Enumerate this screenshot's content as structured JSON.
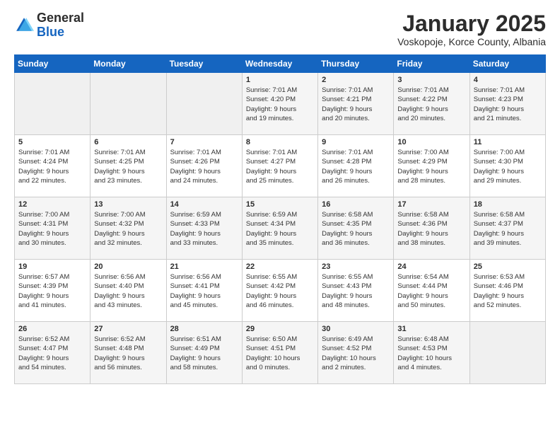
{
  "logo": {
    "general": "General",
    "blue": "Blue"
  },
  "header": {
    "title": "January 2025",
    "subtitle": "Voskopoje, Korce County, Albania"
  },
  "days_of_week": [
    "Sunday",
    "Monday",
    "Tuesday",
    "Wednesday",
    "Thursday",
    "Friday",
    "Saturday"
  ],
  "weeks": [
    [
      {
        "day": "",
        "info": ""
      },
      {
        "day": "",
        "info": ""
      },
      {
        "day": "",
        "info": ""
      },
      {
        "day": "1",
        "info": "Sunrise: 7:01 AM\nSunset: 4:20 PM\nDaylight: 9 hours\nand 19 minutes."
      },
      {
        "day": "2",
        "info": "Sunrise: 7:01 AM\nSunset: 4:21 PM\nDaylight: 9 hours\nand 20 minutes."
      },
      {
        "day": "3",
        "info": "Sunrise: 7:01 AM\nSunset: 4:22 PM\nDaylight: 9 hours\nand 20 minutes."
      },
      {
        "day": "4",
        "info": "Sunrise: 7:01 AM\nSunset: 4:23 PM\nDaylight: 9 hours\nand 21 minutes."
      }
    ],
    [
      {
        "day": "5",
        "info": "Sunrise: 7:01 AM\nSunset: 4:24 PM\nDaylight: 9 hours\nand 22 minutes."
      },
      {
        "day": "6",
        "info": "Sunrise: 7:01 AM\nSunset: 4:25 PM\nDaylight: 9 hours\nand 23 minutes."
      },
      {
        "day": "7",
        "info": "Sunrise: 7:01 AM\nSunset: 4:26 PM\nDaylight: 9 hours\nand 24 minutes."
      },
      {
        "day": "8",
        "info": "Sunrise: 7:01 AM\nSunset: 4:27 PM\nDaylight: 9 hours\nand 25 minutes."
      },
      {
        "day": "9",
        "info": "Sunrise: 7:01 AM\nSunset: 4:28 PM\nDaylight: 9 hours\nand 26 minutes."
      },
      {
        "day": "10",
        "info": "Sunrise: 7:00 AM\nSunset: 4:29 PM\nDaylight: 9 hours\nand 28 minutes."
      },
      {
        "day": "11",
        "info": "Sunrise: 7:00 AM\nSunset: 4:30 PM\nDaylight: 9 hours\nand 29 minutes."
      }
    ],
    [
      {
        "day": "12",
        "info": "Sunrise: 7:00 AM\nSunset: 4:31 PM\nDaylight: 9 hours\nand 30 minutes."
      },
      {
        "day": "13",
        "info": "Sunrise: 7:00 AM\nSunset: 4:32 PM\nDaylight: 9 hours\nand 32 minutes."
      },
      {
        "day": "14",
        "info": "Sunrise: 6:59 AM\nSunset: 4:33 PM\nDaylight: 9 hours\nand 33 minutes."
      },
      {
        "day": "15",
        "info": "Sunrise: 6:59 AM\nSunset: 4:34 PM\nDaylight: 9 hours\nand 35 minutes."
      },
      {
        "day": "16",
        "info": "Sunrise: 6:58 AM\nSunset: 4:35 PM\nDaylight: 9 hours\nand 36 minutes."
      },
      {
        "day": "17",
        "info": "Sunrise: 6:58 AM\nSunset: 4:36 PM\nDaylight: 9 hours\nand 38 minutes."
      },
      {
        "day": "18",
        "info": "Sunrise: 6:58 AM\nSunset: 4:37 PM\nDaylight: 9 hours\nand 39 minutes."
      }
    ],
    [
      {
        "day": "19",
        "info": "Sunrise: 6:57 AM\nSunset: 4:39 PM\nDaylight: 9 hours\nand 41 minutes."
      },
      {
        "day": "20",
        "info": "Sunrise: 6:56 AM\nSunset: 4:40 PM\nDaylight: 9 hours\nand 43 minutes."
      },
      {
        "day": "21",
        "info": "Sunrise: 6:56 AM\nSunset: 4:41 PM\nDaylight: 9 hours\nand 45 minutes."
      },
      {
        "day": "22",
        "info": "Sunrise: 6:55 AM\nSunset: 4:42 PM\nDaylight: 9 hours\nand 46 minutes."
      },
      {
        "day": "23",
        "info": "Sunrise: 6:55 AM\nSunset: 4:43 PM\nDaylight: 9 hours\nand 48 minutes."
      },
      {
        "day": "24",
        "info": "Sunrise: 6:54 AM\nSunset: 4:44 PM\nDaylight: 9 hours\nand 50 minutes."
      },
      {
        "day": "25",
        "info": "Sunrise: 6:53 AM\nSunset: 4:46 PM\nDaylight: 9 hours\nand 52 minutes."
      }
    ],
    [
      {
        "day": "26",
        "info": "Sunrise: 6:52 AM\nSunset: 4:47 PM\nDaylight: 9 hours\nand 54 minutes."
      },
      {
        "day": "27",
        "info": "Sunrise: 6:52 AM\nSunset: 4:48 PM\nDaylight: 9 hours\nand 56 minutes."
      },
      {
        "day": "28",
        "info": "Sunrise: 6:51 AM\nSunset: 4:49 PM\nDaylight: 9 hours\nand 58 minutes."
      },
      {
        "day": "29",
        "info": "Sunrise: 6:50 AM\nSunset: 4:51 PM\nDaylight: 10 hours\nand 0 minutes."
      },
      {
        "day": "30",
        "info": "Sunrise: 6:49 AM\nSunset: 4:52 PM\nDaylight: 10 hours\nand 2 minutes."
      },
      {
        "day": "31",
        "info": "Sunrise: 6:48 AM\nSunset: 4:53 PM\nDaylight: 10 hours\nand 4 minutes."
      },
      {
        "day": "",
        "info": ""
      }
    ]
  ]
}
